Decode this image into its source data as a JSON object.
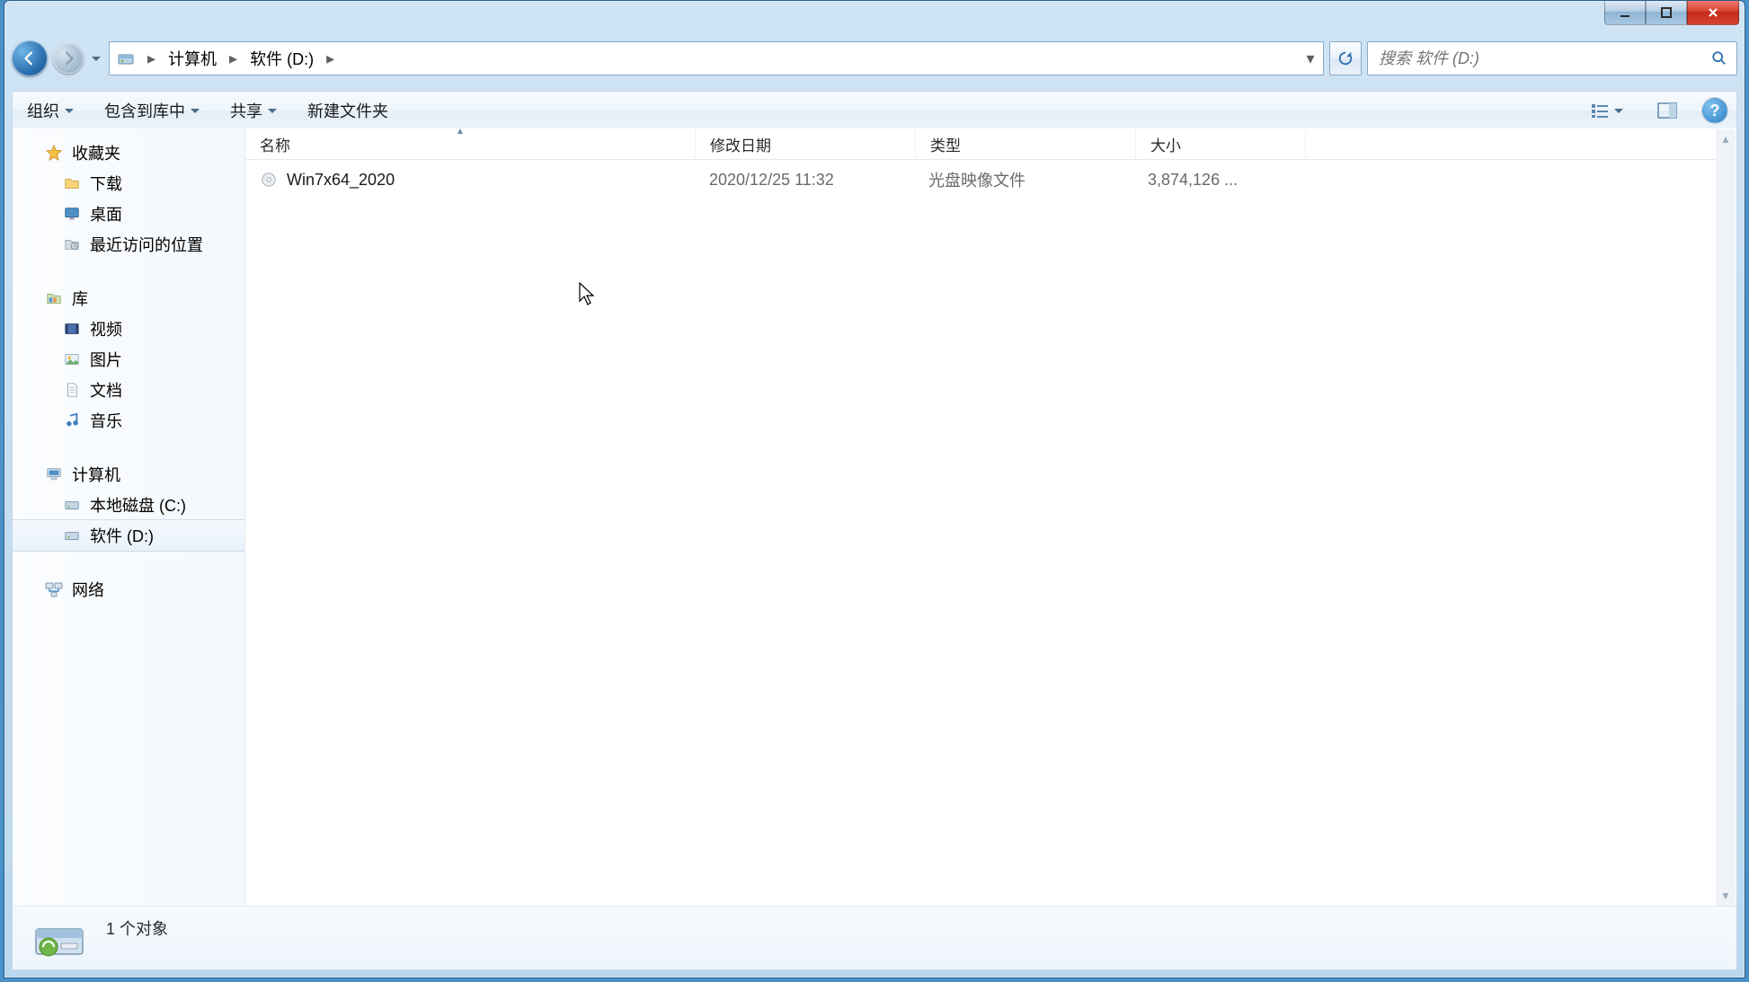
{
  "address": {
    "crumbs": [
      "计算机",
      "软件 (D:)"
    ]
  },
  "search": {
    "placeholder": "搜索 软件 (D:)"
  },
  "toolbar": {
    "organize": "组织",
    "include": "包含到库中",
    "share": "共享",
    "new_folder": "新建文件夹"
  },
  "columns": {
    "name": "名称",
    "date": "修改日期",
    "type": "类型",
    "size": "大小"
  },
  "files": [
    {
      "name": "Win7x64_2020",
      "date": "2020/12/25 11:32",
      "type": "光盘映像文件",
      "size": "3,874,126 ..."
    }
  ],
  "sidebar": {
    "favorites": {
      "label": "收藏夹",
      "items": [
        "下载",
        "桌面",
        "最近访问的位置"
      ]
    },
    "libraries": {
      "label": "库",
      "items": [
        "视频",
        "图片",
        "文档",
        "音乐"
      ]
    },
    "computer": {
      "label": "计算机",
      "items": [
        "本地磁盘 (C:)",
        "软件 (D:)"
      ]
    },
    "network": {
      "label": "网络"
    }
  },
  "statusbar": {
    "text": "1 个对象"
  },
  "help_glyph": "?"
}
